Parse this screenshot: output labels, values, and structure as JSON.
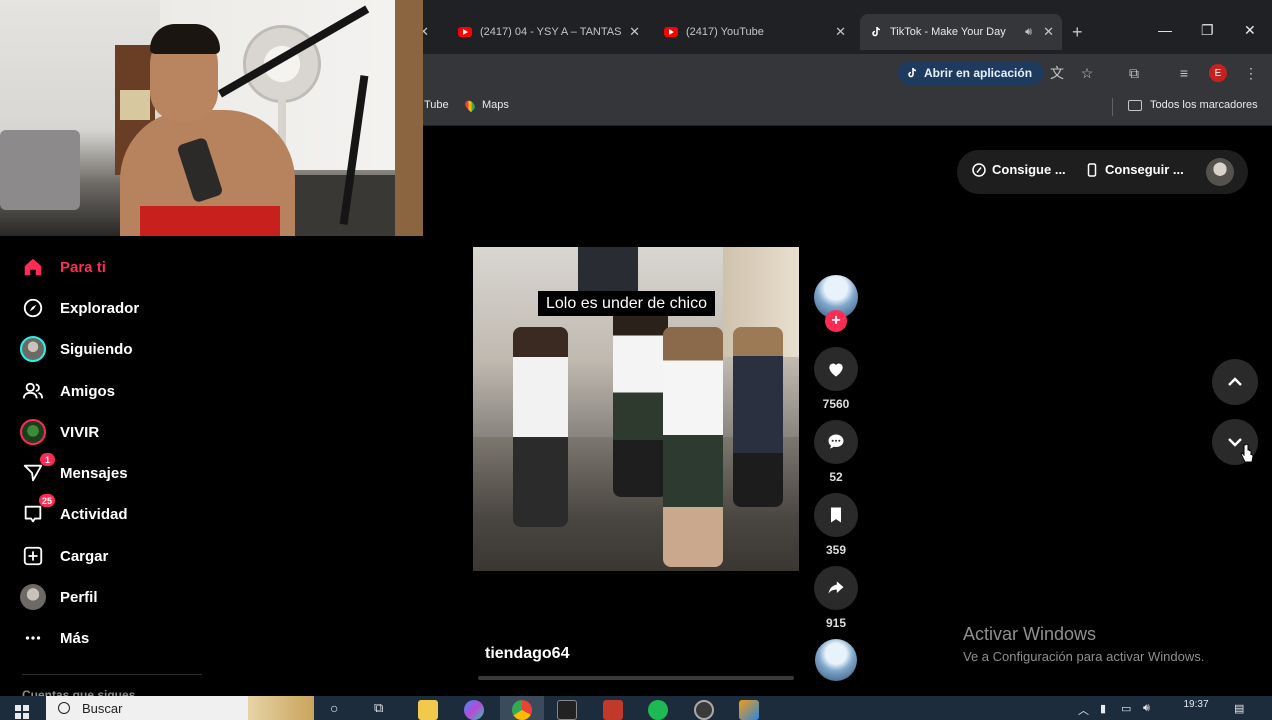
{
  "browser": {
    "tabs": [
      {
        "title": "(2417) 04 - YSY A – TANTAS",
        "favicon": "youtube-icon"
      },
      {
        "title": "(2417) YouTube",
        "favicon": "youtube-icon"
      },
      {
        "title": "TikTok - Make Your Day",
        "favicon": "tiktok-icon",
        "active": true
      }
    ],
    "new_tab": "+",
    "open_in_app": "Abrir en aplicación",
    "profile_initial": "E",
    "bookmarks": {
      "partial": "Tube",
      "maps": "Maps",
      "all": "Todos los marcadores"
    }
  },
  "tiktok": {
    "nav": [
      {
        "label": "Para ti",
        "icon": "home-icon"
      },
      {
        "label": "Explorador",
        "icon": "compass-icon"
      },
      {
        "label": "Siguiendo",
        "icon": "following-avatar"
      },
      {
        "label": "Amigos",
        "icon": "friends-icon"
      },
      {
        "label": "VIVIR",
        "icon": "live-avatar"
      },
      {
        "label": "Mensajes",
        "icon": "messages-icon",
        "badge": "1"
      },
      {
        "label": "Actividad",
        "icon": "activity-icon",
        "badge": "25"
      },
      {
        "label": "Cargar",
        "icon": "upload-icon"
      },
      {
        "label": "Perfil",
        "icon": "profile-avatar"
      },
      {
        "label": "Más",
        "icon": "more-icon"
      }
    ],
    "following_section": "Cuentas que sigues",
    "top_pills": {
      "coins": "Consigue ...",
      "app": "Conseguir ..."
    },
    "video": {
      "caption": "Lolo es under de chico",
      "author": "tiendago64"
    },
    "actions": {
      "likes": "7560",
      "comments": "52",
      "saves": "359",
      "shares": "915"
    }
  },
  "watermark": {
    "line1": "Activar Windows",
    "line2": "Ve a Configuración para activar Windows."
  },
  "taskbar": {
    "search": "Buscar",
    "time": "19:37"
  },
  "colors": {
    "accent": "#fe2c55",
    "teal": "#25f4ee"
  }
}
